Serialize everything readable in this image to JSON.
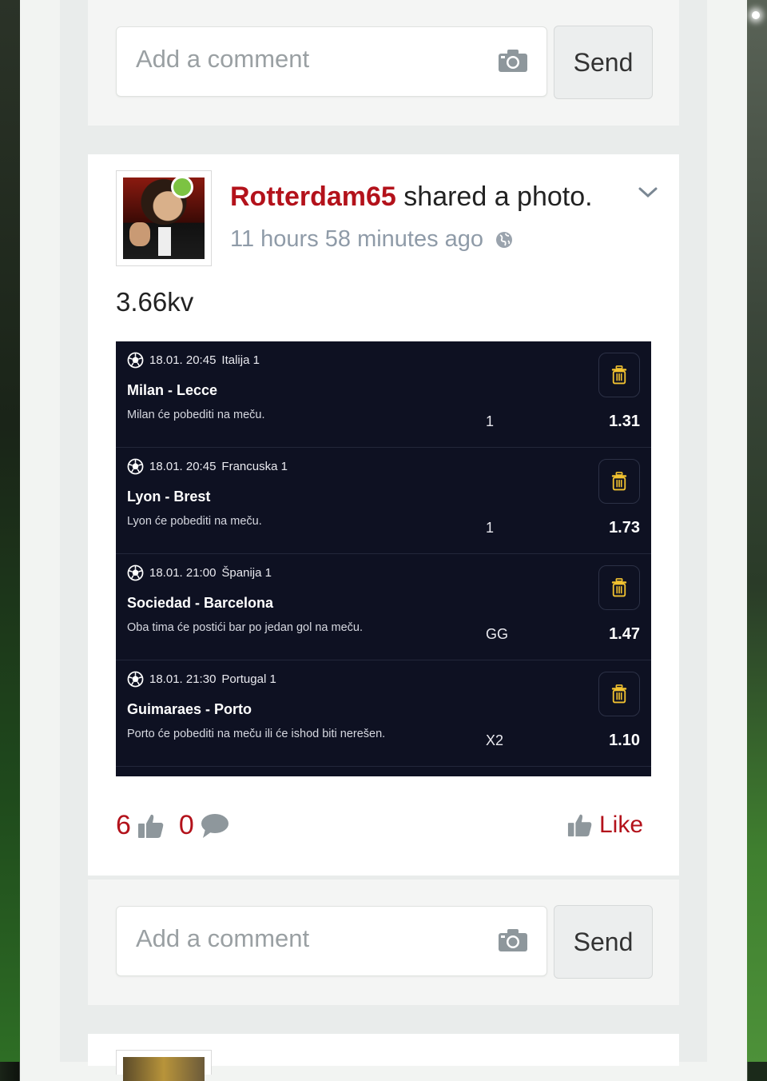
{
  "comment_top": {
    "placeholder": "Add a comment",
    "send_label": "Send"
  },
  "post": {
    "author": "Rotterdam65",
    "action": " shared a photo.",
    "time": "11 hours 58 minutes ago",
    "caption": "3.66kv",
    "bets": [
      {
        "datetime": "18.01. 20:45",
        "league": "Italija 1",
        "match": "Milan - Lecce",
        "description": "Milan će pobediti na meču.",
        "pick": "1",
        "odd": "1.31"
      },
      {
        "datetime": "18.01. 20:45",
        "league": "Francuska 1",
        "match": "Lyon - Brest",
        "description": "Lyon će pobediti na meču.",
        "pick": "1",
        "odd": "1.73"
      },
      {
        "datetime": "18.01. 21:00",
        "league": "Španija 1",
        "match": "Sociedad - Barcelona",
        "description": "Oba tima će postići bar po jedan gol na meču.",
        "pick": "GG",
        "odd": "1.47"
      },
      {
        "datetime": "18.01. 21:30",
        "league": "Portugal 1",
        "match": "Guimaraes - Porto",
        "description": "Porto će pobediti na meču ili će ishod biti nerešen.",
        "pick": "X2",
        "odd": "1.10"
      }
    ],
    "likes_count": "6",
    "comments_count": "0",
    "like_label": "Like"
  },
  "comment_bottom": {
    "placeholder": "Add a comment",
    "send_label": "Send"
  },
  "colors": {
    "accent": "#b3121b",
    "online": "#7cc342",
    "slip_bg": "#0e1122"
  },
  "icons": [
    "camera-icon",
    "globe-icon",
    "chevron-down-icon",
    "soccer-ball-icon",
    "trash-icon",
    "thumbs-up-icon",
    "comment-bubble-icon"
  ]
}
